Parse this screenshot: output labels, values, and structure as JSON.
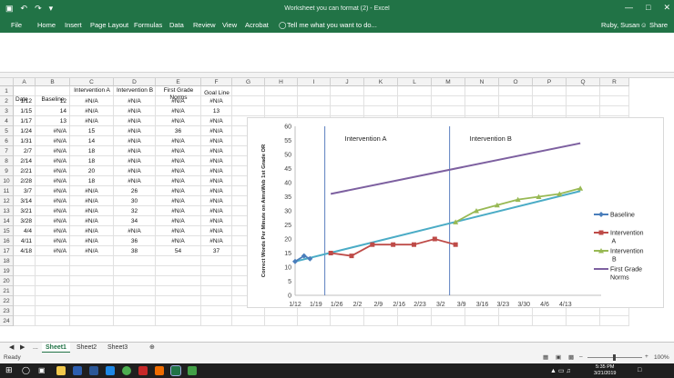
{
  "window": {
    "title": "Worksheet you can format (2) - Excel",
    "user": "Ruby, Susan",
    "share_label": "Share",
    "tell_me": "Tell me what you want to do..."
  },
  "ribbon_tabs": [
    "File",
    "Home",
    "Insert",
    "Page Layout",
    "Formulas",
    "Data",
    "Review",
    "View",
    "Acrobat"
  ],
  "columns": [
    "A",
    "B",
    "C",
    "D",
    "E",
    "F",
    "G",
    "H",
    "I",
    "J",
    "K",
    "L",
    "M",
    "N",
    "O",
    "P",
    "Q",
    "R"
  ],
  "row_numbers": [
    "1",
    "2",
    "3",
    "4",
    "5",
    "6",
    "7",
    "8",
    "9",
    "10",
    "11",
    "12",
    "13",
    "14",
    "15",
    "16",
    "17",
    "18",
    "19",
    "20",
    "21",
    "22",
    "23",
    "24"
  ],
  "sheet": {
    "headers": [
      "Date",
      "Baseline",
      "Intervention A",
      "Intervention B",
      "First Grade Norms",
      "Goal Line"
    ],
    "rows": [
      [
        "1/12",
        "12",
        "#N/A",
        "#N/A",
        "#N/A",
        "#N/A"
      ],
      [
        "1/15",
        "14",
        "#N/A",
        "#N/A",
        "#N/A",
        "13"
      ],
      [
        "1/17",
        "13",
        "#N/A",
        "#N/A",
        "#N/A",
        "#N/A"
      ],
      [
        "1/24",
        "#N/A",
        "15",
        "#N/A",
        "36",
        "#N/A"
      ],
      [
        "1/31",
        "#N/A",
        "14",
        "#N/A",
        "#N/A",
        "#N/A"
      ],
      [
        "2/7",
        "#N/A",
        "18",
        "#N/A",
        "#N/A",
        "#N/A"
      ],
      [
        "2/14",
        "#N/A",
        "18",
        "#N/A",
        "#N/A",
        "#N/A"
      ],
      [
        "2/21",
        "#N/A",
        "20",
        "#N/A",
        "#N/A",
        "#N/A"
      ],
      [
        "2/28",
        "#N/A",
        "18",
        "#N/A",
        "#N/A",
        "#N/A"
      ],
      [
        "3/7",
        "#N/A",
        "#N/A",
        "26",
        "#N/A",
        "#N/A"
      ],
      [
        "3/14",
        "#N/A",
        "#N/A",
        "30",
        "#N/A",
        "#N/A"
      ],
      [
        "3/21",
        "#N/A",
        "#N/A",
        "32",
        "#N/A",
        "#N/A"
      ],
      [
        "3/28",
        "#N/A",
        "#N/A",
        "34",
        "#N/A",
        "#N/A"
      ],
      [
        "4/4",
        "#N/A",
        "#N/A",
        "#N/A",
        "#N/A",
        "#N/A"
      ],
      [
        "4/11",
        "#N/A",
        "#N/A",
        "36",
        "#N/A",
        "#N/A"
      ],
      [
        "4/18",
        "#N/A",
        "#N/A",
        "38",
        "54",
        "37"
      ]
    ]
  },
  "sheet_tabs": [
    "...",
    "Sheet1",
    "Sheet2",
    "Sheet3"
  ],
  "status": {
    "ready": "Ready",
    "zoom": "100%"
  },
  "taskbar": {
    "time": "5:35 PM",
    "date": "3/21/2019"
  },
  "chart_data": {
    "type": "line",
    "ylabel": "Correct Words Per Minute on AimsWeb 1st Grade OR",
    "ylim": [
      0,
      60
    ],
    "yticks": [
      0,
      5,
      10,
      15,
      20,
      25,
      30,
      35,
      40,
      45,
      50,
      55,
      60
    ],
    "x_tick_labels": [
      "1/12",
      "1/19",
      "1/26",
      "2/2",
      "2/9",
      "2/16",
      "2/23",
      "3/2",
      "3/9",
      "3/16",
      "3/23",
      "3/30",
      "4/6",
      "4/13"
    ],
    "x_range_days": [
      0,
      103
    ],
    "phase_lines": [
      {
        "day": 10,
        "label": "Intervention A"
      },
      {
        "day": 52,
        "label": "Intervention B"
      }
    ],
    "series": [
      {
        "name": "Baseline",
        "color": "#4a7ebb",
        "marker": "diamond",
        "x": [
          0,
          3,
          5
        ],
        "y": [
          12,
          14,
          13
        ]
      },
      {
        "name": "Intervention A",
        "color": "#be4b48",
        "marker": "square",
        "x": [
          12,
          19,
          26,
          33,
          40,
          47,
          54
        ],
        "y": [
          15,
          14,
          18,
          18,
          18,
          20,
          18
        ]
      },
      {
        "name": "Intervention B",
        "color": "#98b954",
        "marker": "triangle",
        "x": [
          54,
          61,
          68,
          75,
          82,
          89,
          96
        ],
        "y": [
          26,
          30,
          32,
          34,
          35,
          36,
          38
        ]
      },
      {
        "name": "First Grade Norms",
        "color": "#7d60a0",
        "marker": "none",
        "x": [
          12,
          96
        ],
        "y": [
          36,
          54
        ]
      }
    ],
    "goal_line": {
      "color": "#4bacc6",
      "x": [
        0,
        96
      ],
      "y": [
        12,
        37
      ]
    }
  }
}
